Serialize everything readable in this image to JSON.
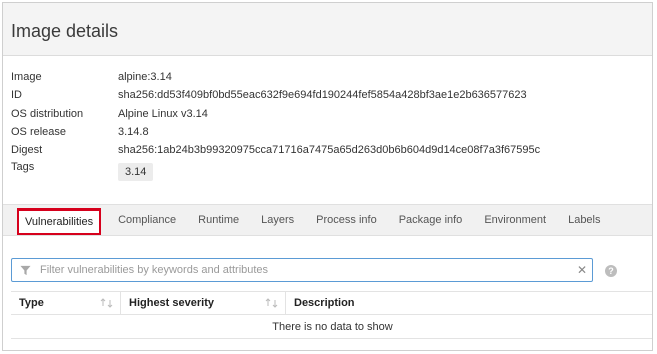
{
  "panel": {
    "title": "Image details"
  },
  "details": [
    {
      "label": "Image",
      "value": "alpine:3.14"
    },
    {
      "label": "ID",
      "value": "sha256:dd53f409bf0bd55eac632f9e694fd190244fef5854a428bf3ae1e2b636577623"
    },
    {
      "label": "OS distribution",
      "value": "Alpine Linux v3.14"
    },
    {
      "label": "OS release",
      "value": "3.14.8"
    },
    {
      "label": "Digest",
      "value": "sha256:1ab24b3b99320975cca71716a7475a65d263d0b6b604d9d14ce08f7a3f67595c"
    }
  ],
  "tags": {
    "label": "Tags",
    "items": [
      "3.14"
    ]
  },
  "tabs": [
    {
      "label": "Vulnerabilities",
      "active": true
    },
    {
      "label": "Compliance"
    },
    {
      "label": "Runtime"
    },
    {
      "label": "Layers"
    },
    {
      "label": "Process info"
    },
    {
      "label": "Package info"
    },
    {
      "label": "Environment"
    },
    {
      "label": "Labels"
    }
  ],
  "filter": {
    "placeholder": "Filter vulnerabilities by keywords and attributes",
    "value": ""
  },
  "table": {
    "columns": [
      "Type",
      "Highest severity",
      "Description"
    ],
    "empty_message": "There is no data to show"
  },
  "colors": {
    "active_tab_border": "#d6001c",
    "filter_border": "#5b9bd5"
  },
  "icons": {
    "filter": "funnel-icon",
    "clear": "close-icon",
    "help": "help-icon",
    "sort": "sort-icon"
  }
}
